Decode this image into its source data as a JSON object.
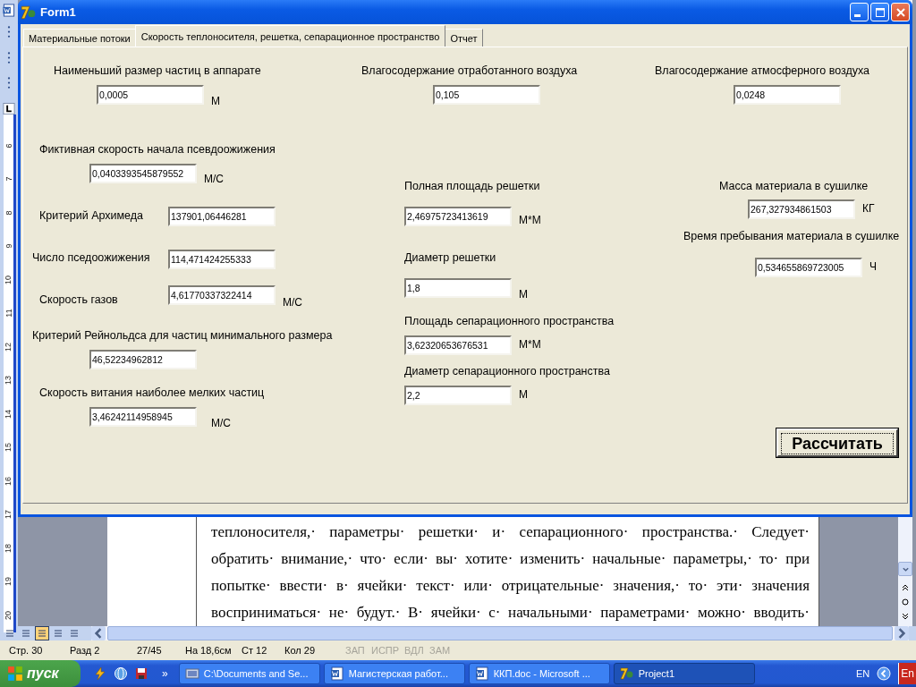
{
  "word": {
    "ruler": [
      "6",
      "7",
      "8",
      "9",
      "10",
      "11",
      "12",
      "13",
      "14",
      "15",
      "16",
      "17",
      "18",
      "19",
      "20"
    ],
    "document_lines": [
      "теплоносителя,· параметры· решетки· и· сепарационного· пространства.· Следует·",
      "обратить· внимание,· что· если· вы· хотите· изменить· начальные· параметры,· то· при",
      "попытке· ввести· в· ячейки· текст· или· отрицательные· значения,· то· эти· значения",
      "восприниматься· не· будут.· В· ячейки· с· начальными· параметрами· можно· вводить·"
    ],
    "status_bar": [
      {
        "text": "Стр. 30",
        "disabled": false
      },
      {
        "text": "Разд 2",
        "disabled": false
      },
      {
        "text": "27/45",
        "disabled": false
      },
      {
        "text": "На 18,6см",
        "disabled": false
      },
      {
        "text": "Ст 12",
        "disabled": false
      },
      {
        "text": "Кол 29",
        "disabled": false
      },
      {
        "text": "ЗАП",
        "disabled": true
      },
      {
        "text": "ИСПР",
        "disabled": true
      },
      {
        "text": "ВДЛ",
        "disabled": true
      },
      {
        "text": "ЗАМ",
        "disabled": true
      }
    ]
  },
  "form": {
    "title": "Form1",
    "tabs": [
      {
        "label": "Материальные потоки",
        "selected": false
      },
      {
        "label": "Скорость теплоносителя, решетка, сепарационное пространство",
        "selected": true
      },
      {
        "label": "Отчет",
        "selected": false
      }
    ],
    "fields": [
      {
        "label": "Наименьший размер частиц в аппарате",
        "value": "0,0005",
        "unit": "М"
      },
      {
        "label": "Влагосодержание отработанного воздуха",
        "value": "0,105"
      },
      {
        "label": "Влагосодержание атмосферного воздуха",
        "value": "0,0248"
      },
      {
        "label": "Фиктивная скорость начала псевдоожижения",
        "value": "0,0403393545879552",
        "unit": "М/С"
      },
      {
        "label": "Критерий Архимеда",
        "value": "137901,06446281"
      },
      {
        "label": "Число пседоожижения",
        "value": "114,471424255333"
      },
      {
        "label": "Скорость газов",
        "value": "4,61770337322414",
        "unit": "М/С"
      },
      {
        "label": "Критерий Рейнольдса для частиц минимального размера",
        "value": "46,52234962812"
      },
      {
        "label": "Скорость витания наиболее мелких частиц",
        "value": "3,46242114958945",
        "unit": "М/С"
      },
      {
        "label": "Полная площадь решетки",
        "value": "2,46975723413619",
        "unit": "М*М"
      },
      {
        "label": "Диаметр решетки",
        "value": "1,8",
        "unit": "М"
      },
      {
        "label": "Площадь сепарационного пространства",
        "value": "3,62320653676531",
        "unit": "М*М"
      },
      {
        "label": "Диаметр сепарационного пространства",
        "value": "2,2",
        "unit": "М"
      },
      {
        "label": "Масса материала в сушилке",
        "value": "267,327934861503",
        "unit": "КГ"
      },
      {
        "label": "Время пребывания материала в сушилке",
        "value": "0,534655869723005",
        "unit": "Ч"
      }
    ],
    "button": "Рассчитать"
  },
  "taskbar": {
    "start": "пуск",
    "more": "»",
    "tasks": [
      {
        "label": "C:\\Documents and Se...",
        "kind": "folder",
        "selected": false
      },
      {
        "label": "Магистерская работ...",
        "kind": "word",
        "selected": false
      },
      {
        "label": "ККП.doc - Microsoft ...",
        "kind": "word",
        "selected": false
      },
      {
        "label": "Project1",
        "kind": "delphi",
        "selected": true
      }
    ],
    "language": "EN",
    "ime": "En"
  }
}
